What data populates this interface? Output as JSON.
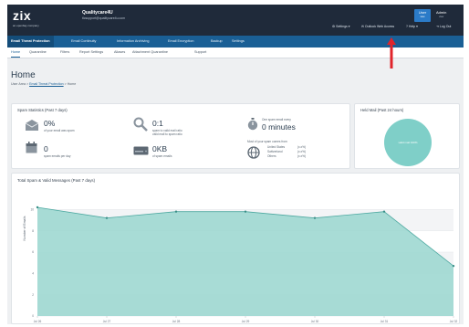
{
  "header": {
    "logo": "zix",
    "logo_sub": "an openbay company",
    "org_name": "Qualitycare4U",
    "org_email": "tlcsupport@qualitycare4u.com",
    "links": {
      "settings": "Settings",
      "outlook": "Outlook Web Access",
      "help": "Help",
      "logout": "Log Out"
    },
    "user_label": "User",
    "user_sub": "view",
    "admin_label": "Admin",
    "admin_sub": "view"
  },
  "mainnav": {
    "tabs": [
      "Email Threat Protection",
      "Email Continuity",
      "Information Archiving",
      "Email Encryption",
      "Backup",
      "Settings"
    ]
  },
  "subnav": {
    "tabs": [
      "Home",
      "Quarantine",
      "Filters",
      "Report Settings",
      "Aliases",
      "Attachment Quarantine",
      "Support"
    ]
  },
  "page": {
    "title": "Home",
    "crumbs": {
      "part1": "User Area",
      "sep": ">",
      "part2": "Email Threat Protection",
      "part3": "Home"
    }
  },
  "spam": {
    "title": "Spam Statistics (Past 7 days)",
    "pct_value": "0%",
    "pct_desc": "of your email was spam",
    "ratio_value": "0:1",
    "ratio_desc1": "spam to valid mail ratio",
    "ratio_desc2": "valid mail to spam ratio",
    "every_label": "One spam email every",
    "every_value": "0 minutes",
    "per_day_value": "0",
    "per_day_desc": "spam emails per day",
    "size_value": "0KB",
    "size_desc": "of spam emails",
    "countries_title": "Most of your spam comes from",
    "countries": [
      {
        "name": "United States",
        "pct": "(x.x%)"
      },
      {
        "name": "Switzerland",
        "pct": "(x.x%)"
      },
      {
        "name": "Others",
        "pct": "(x.x%)"
      }
    ]
  },
  "held": {
    "title": "Held Mail (Past 24 hours)",
    "pie_label": "valid mail 100%",
    "color": "#7fcfc8"
  },
  "chart_data": {
    "type": "area",
    "title": "Total Spam & Valid Messages (Past 7 days)",
    "ylabel": "Number of Emails",
    "yticks": [
      "10",
      "8",
      "6",
      "4",
      "2",
      "0"
    ],
    "ylim": [
      0,
      12
    ],
    "x": [
      "Jul 26",
      "Jul 27",
      "Jul 28",
      "Jul 29",
      "Jul 30",
      "Jul 31",
      "Jul 32"
    ],
    "series": [
      {
        "values": [
          10.2,
          9.2,
          9.8,
          9.8,
          9.2,
          9.8,
          4.7
        ],
        "color": "#9ed8d2"
      }
    ]
  }
}
